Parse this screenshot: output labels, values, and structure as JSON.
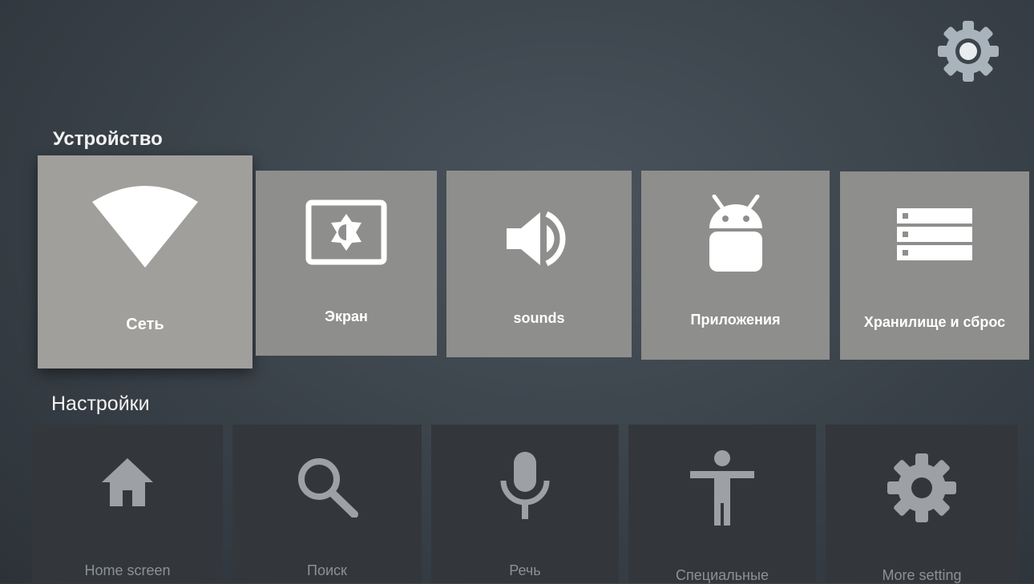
{
  "header": {
    "settings_icon": "gear-icon"
  },
  "device_section": {
    "title": "Устройство",
    "items": [
      {
        "label": "Сеть",
        "icon": "wifi-icon"
      },
      {
        "label": "Экран",
        "icon": "brightness-icon"
      },
      {
        "label": "sounds",
        "icon": "volume-icon"
      },
      {
        "label": "Приложения",
        "icon": "android-icon"
      },
      {
        "label": "Хранилище и сброс",
        "icon": "storage-icon"
      }
    ]
  },
  "settings_section": {
    "title": "Настройки",
    "items": [
      {
        "label": "Home screen",
        "icon": "home-icon"
      },
      {
        "label": "Поиск",
        "icon": "search-icon"
      },
      {
        "label": "Речь",
        "icon": "microphone-icon"
      },
      {
        "label": "Специальные",
        "icon": "accessibility-icon"
      },
      {
        "label": "More setting",
        "icon": "gear-icon"
      }
    ]
  },
  "colors": {
    "card": "#8e8e8c",
    "card_focused": "#a09f9c",
    "row2_card": "#33373b",
    "icon_light": "#ffffff",
    "icon_dim": "#9da1a5"
  }
}
